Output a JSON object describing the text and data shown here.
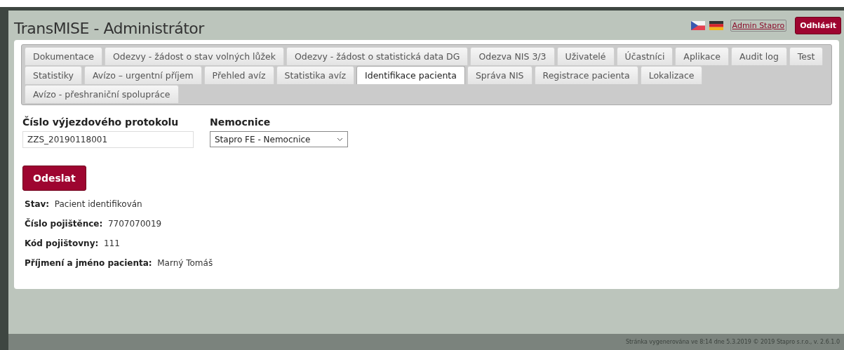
{
  "header": {
    "title": "TransMISE - Administrátor",
    "languages": [
      {
        "kind": "cz"
      },
      {
        "kind": "de"
      }
    ],
    "user_link": "Admin Stapro",
    "logout_button": "Odhlásit"
  },
  "tab_rows": [
    [
      {
        "label": "Dokumentace",
        "selected": false
      },
      {
        "label": "Odezvy - žádost o stav volných lůžek",
        "selected": false
      },
      {
        "label": "Odezvy - žádost o statistická data DG",
        "selected": false
      },
      {
        "label": "Odezva NIS 3/3",
        "selected": false
      },
      {
        "label": "Uživatelé",
        "selected": false
      },
      {
        "label": "Účastníci",
        "selected": false
      },
      {
        "label": "Aplikace",
        "selected": false
      },
      {
        "label": "Audit log",
        "selected": false
      },
      {
        "label": "Test",
        "selected": false
      }
    ],
    [
      {
        "label": "Statistiky",
        "selected": false
      },
      {
        "label": "Avízo – urgentní příjem",
        "selected": false
      },
      {
        "label": "Přehled avíz",
        "selected": false
      },
      {
        "label": "Statistika avíz",
        "selected": false
      },
      {
        "label": "Identifikace pacienta",
        "selected": true
      },
      {
        "label": "Správa NIS",
        "selected": false
      },
      {
        "label": "Registrace pacienta",
        "selected": false
      },
      {
        "label": "Lokalizace",
        "selected": false
      }
    ],
    [
      {
        "label": "Avízo - přeshraniční spolupráce",
        "selected": false
      }
    ]
  ],
  "form": {
    "fields": [
      {
        "kind": "text",
        "label": "Číslo výjezdového protokolu",
        "value": "ZZS_20190118001"
      },
      {
        "kind": "select",
        "label": "Nemocnice",
        "value": "Stapro FE - Nemocnice"
      }
    ],
    "submit_button": "Odeslat"
  },
  "results": [
    {
      "label": "Stav:",
      "value": "Pacient identifikován"
    },
    {
      "label": "Číslo pojištěnce:",
      "value": "7707070019"
    },
    {
      "label": "Kód pojištovny:",
      "value": "111"
    },
    {
      "label": "Příjmení a jméno pacienta:",
      "value": "Marný Tomáš"
    }
  ],
  "footer": "Stránka vygenerována ve 8:14 dne 5.3.2019 © 2019 Stapro s.r.o., v. 2.6.1.0"
}
